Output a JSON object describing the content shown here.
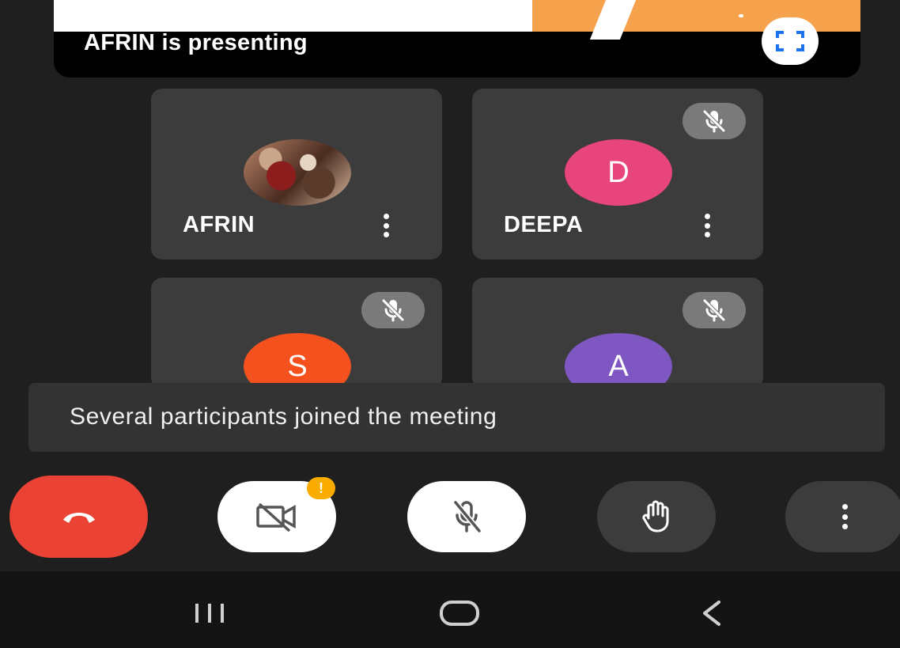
{
  "presenting": {
    "label": "AFRIN is presenting",
    "fullscreen_icon": "fullscreen-icon"
  },
  "participants": [
    {
      "name": "AFRIN",
      "initial": "",
      "avatar": "photo",
      "muted": false
    },
    {
      "name": "DEEPA",
      "initial": "D",
      "avatar_color": "#e8457c",
      "muted": true
    },
    {
      "name": "",
      "initial": "S",
      "avatar_color": "#f4511e",
      "muted": true
    },
    {
      "name": "",
      "initial": "A",
      "avatar_color": "#7e57c2",
      "muted": true
    }
  ],
  "toast": {
    "text": "Several participants joined the meeting"
  },
  "controls": {
    "end_call_icon": "phone-hangup-icon",
    "camera_icon": "camera-off-icon",
    "camera_alert": "!",
    "mic_icon": "mic-off-icon",
    "hand_icon": "raise-hand-icon",
    "more_icon": "more-vertical-icon"
  },
  "navbar": {
    "recents_icon": "recents-icon",
    "home_icon": "home-icon",
    "back_icon": "back-icon"
  },
  "colors": {
    "end_call": "#ea4335",
    "alert": "#f9ab00",
    "tile_bg": "#3c3c3c"
  }
}
